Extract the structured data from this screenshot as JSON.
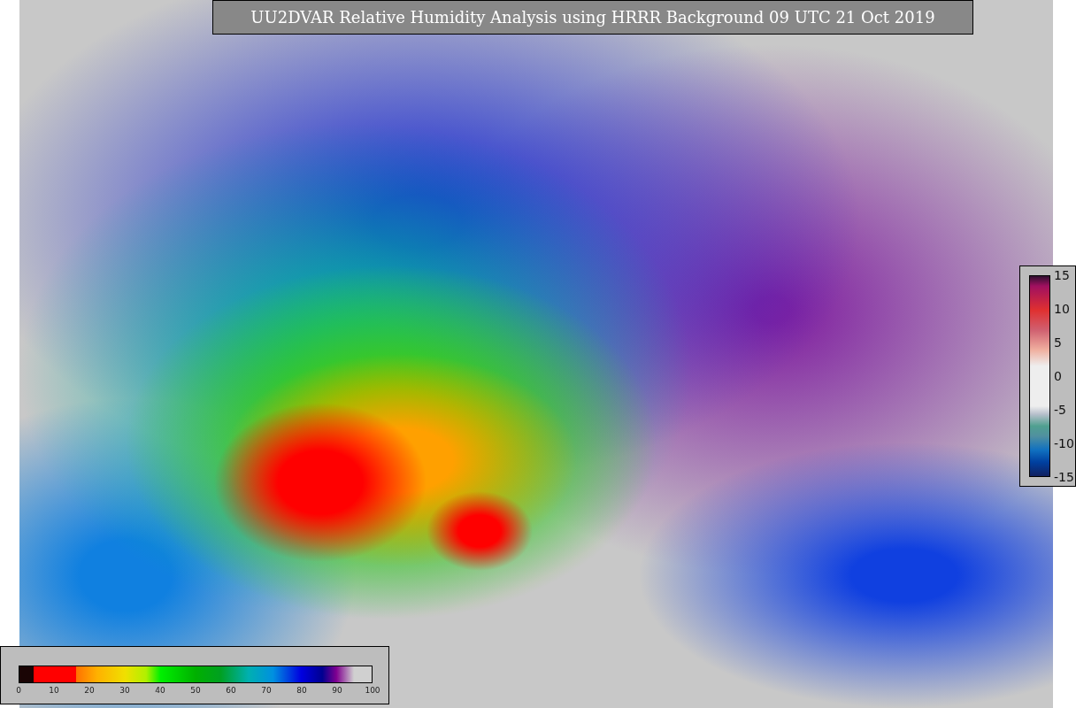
{
  "title": "UU2DVAR Relative Humidity Analysis using HRRR Background 09 UTC 21 Oct 2019",
  "humidity_colorbar": {
    "ticks": [
      "0",
      "10",
      "20",
      "30",
      "40",
      "50",
      "60",
      "70",
      "80",
      "90",
      "100"
    ]
  },
  "increment_colorbar": {
    "ticks": [
      "15",
      "10",
      "5",
      "0",
      "-5",
      "-10",
      "-15"
    ]
  }
}
